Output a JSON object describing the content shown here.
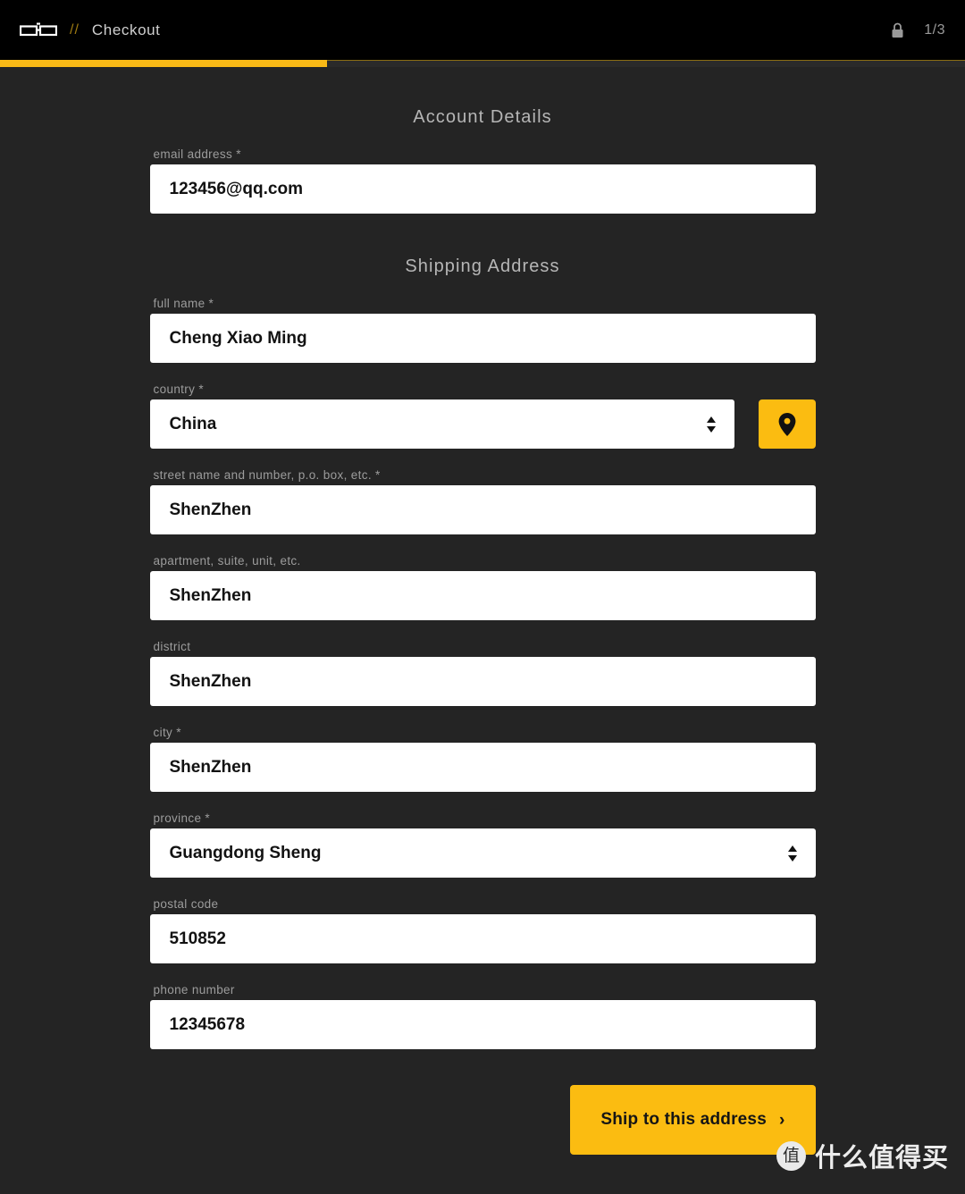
{
  "header": {
    "logo_name": "db-logo",
    "separator": "//",
    "breadcrumb": "Checkout",
    "lock_icon": "lock-icon",
    "page_indicator": "1/3"
  },
  "progress": {
    "percent": 33.9,
    "fill_color": "#f8b916",
    "track_color": "#2a2a2a"
  },
  "theme": {
    "page_background": "#242424",
    "header_background": "#000000",
    "accent": "#fbbc11",
    "input_background": "#ffffff",
    "label_color": "#9c9c9c",
    "value_color": "#121212"
  },
  "sections": {
    "account": {
      "title": "Account Details",
      "fields": [
        {
          "name": "email",
          "label": "email address *",
          "value": "123456@qq.com",
          "placeholder": "",
          "type": "text"
        }
      ]
    },
    "shipping": {
      "title": "Shipping Address",
      "fields": [
        {
          "name": "full-name",
          "label": "full name *",
          "value": "Cheng Xiao Ming",
          "placeholder": "",
          "type": "text"
        },
        {
          "name": "country",
          "label": "country *",
          "value": "China",
          "placeholder": "",
          "type": "select",
          "has_pin_button": true,
          "pin_icon": "map-pin-icon"
        },
        {
          "name": "street",
          "label": "street name and number, p.o. box, etc. *",
          "value": "ShenZhen",
          "placeholder": "",
          "type": "text"
        },
        {
          "name": "apartment",
          "label": "apartment, suite, unit, etc.",
          "value": "ShenZhen",
          "placeholder": "",
          "type": "text"
        },
        {
          "name": "district",
          "label": "district",
          "value": "ShenZhen",
          "placeholder": "",
          "type": "text"
        },
        {
          "name": "city",
          "label": "city *",
          "value": "ShenZhen",
          "placeholder": "",
          "type": "text"
        },
        {
          "name": "province",
          "label": "province *",
          "value": "Guangdong Sheng",
          "placeholder": "",
          "type": "select",
          "has_pin_button": false
        },
        {
          "name": "postal-code",
          "label": "postal code",
          "value": "510852",
          "placeholder": "",
          "type": "text"
        },
        {
          "name": "phone",
          "label": "phone number",
          "value": "12345678",
          "placeholder": "",
          "type": "text"
        }
      ]
    }
  },
  "submit": {
    "label": "Ship to this address",
    "chevron": "›"
  },
  "watermark": {
    "badge": "值",
    "text": "什么值得买"
  }
}
